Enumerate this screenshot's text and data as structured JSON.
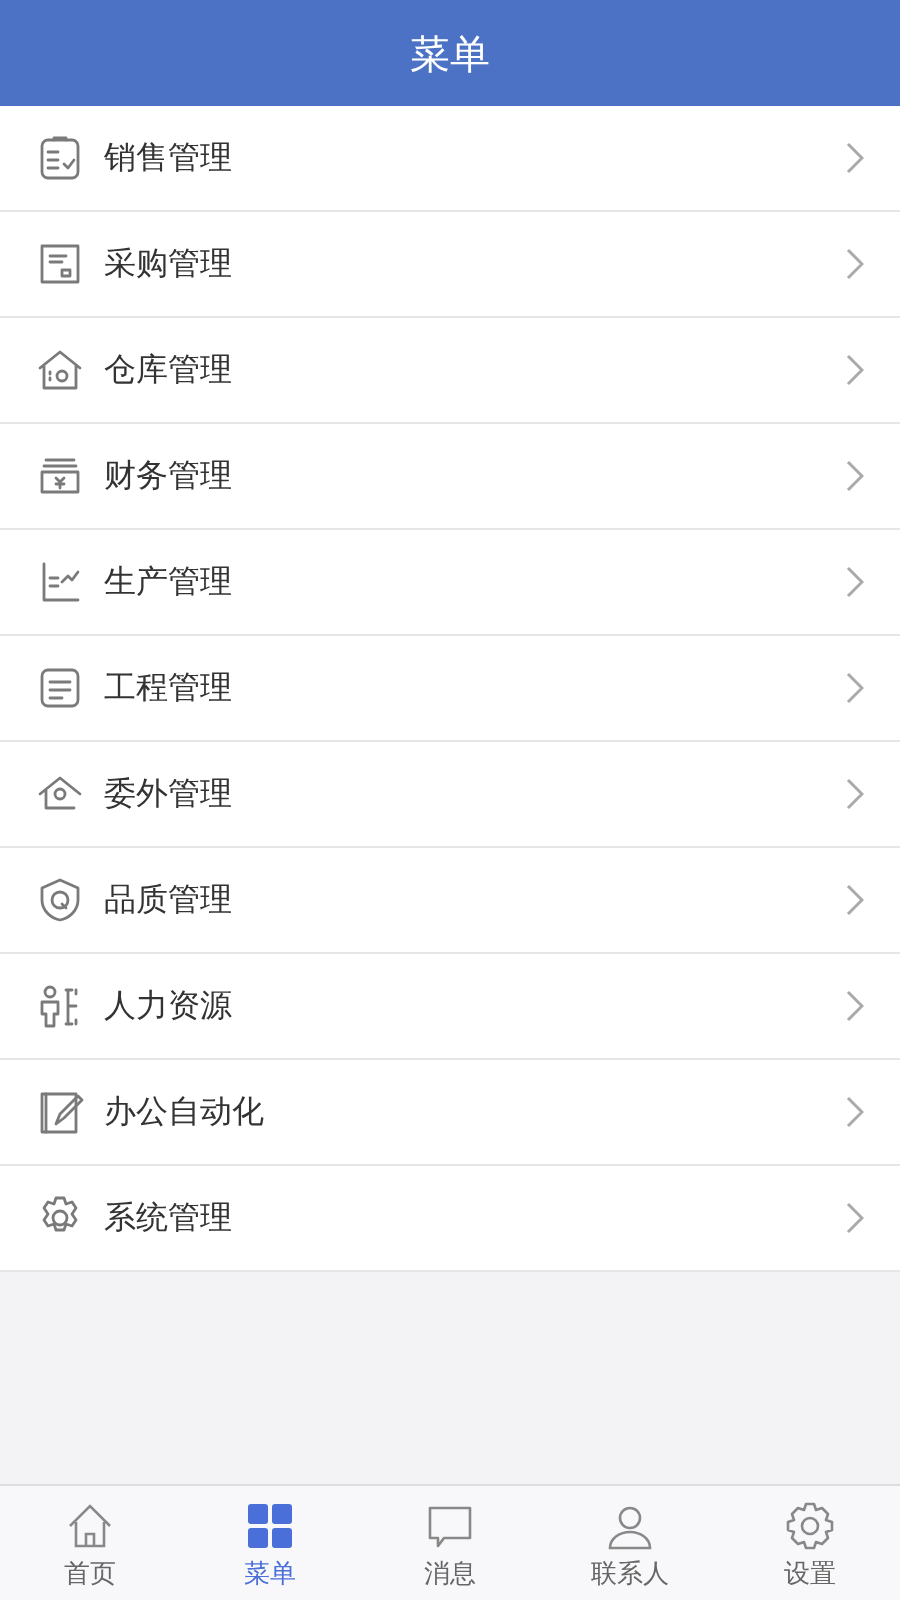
{
  "header": {
    "title": "菜单"
  },
  "menu": [
    {
      "label": "销售管理"
    },
    {
      "label": "采购管理"
    },
    {
      "label": "仓库管理"
    },
    {
      "label": "财务管理"
    },
    {
      "label": "生产管理"
    },
    {
      "label": "工程管理"
    },
    {
      "label": "委外管理"
    },
    {
      "label": "品质管理"
    },
    {
      "label": "人力资源"
    },
    {
      "label": "办公自动化"
    },
    {
      "label": "系统管理"
    }
  ],
  "tab_bar": [
    {
      "label": "首页",
      "selected": false
    },
    {
      "label": "菜单",
      "selected": true
    },
    {
      "label": "消息",
      "selected": false
    },
    {
      "label": "联系人",
      "selected": false
    },
    {
      "label": "设置",
      "selected": false
    }
  ]
}
